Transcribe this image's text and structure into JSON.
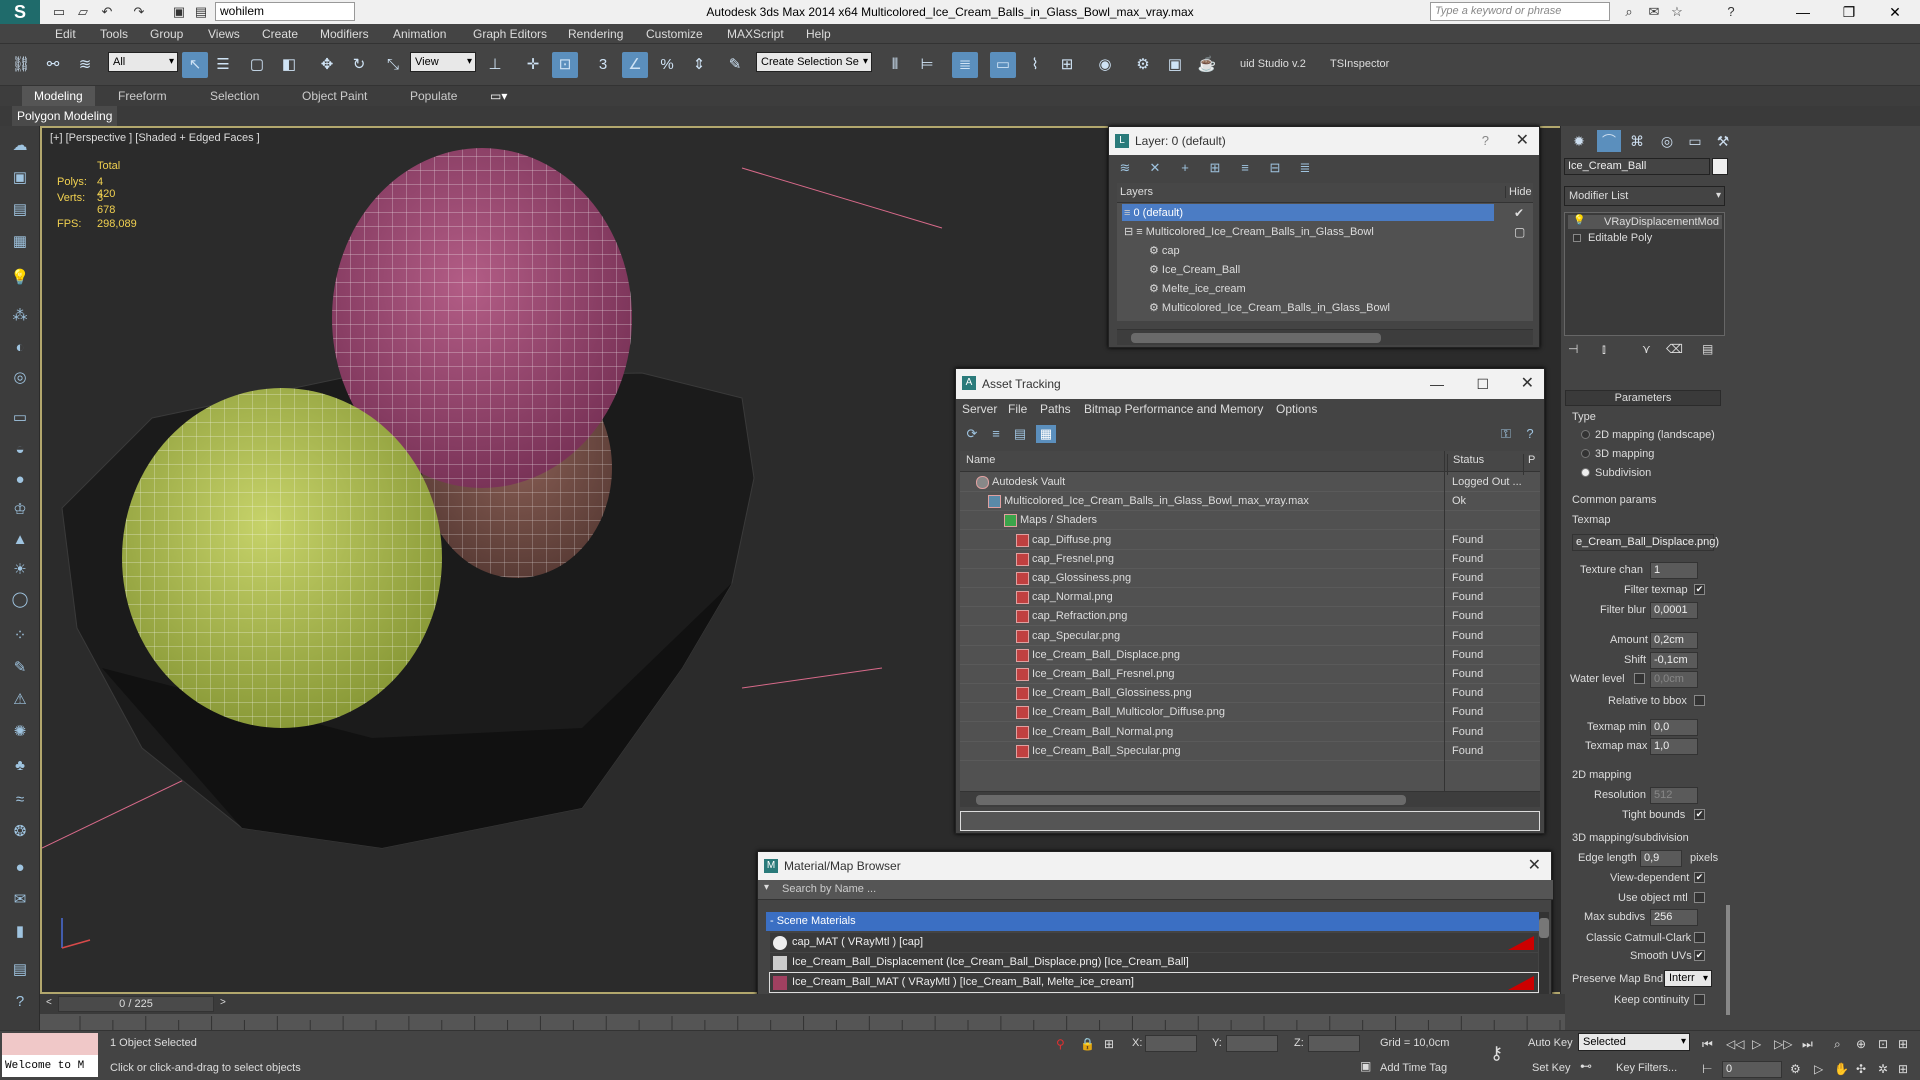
{
  "titlebar": {
    "workspace": "wohilem",
    "title": "Autodesk 3ds Max  2014 x64     Multicolored_Ice_Cream_Balls_in_Glass_Bowl_max_vray.max",
    "search_placeholder": "Type a keyword or phrase"
  },
  "menu": [
    "Edit",
    "Tools",
    "Group",
    "Views",
    "Create",
    "Modifiers",
    "Animation",
    "Graph Editors",
    "Rendering",
    "Customize",
    "MAXScript",
    "Help"
  ],
  "toolbar": {
    "selection_filter": "All",
    "ref_coord": "View",
    "named_selection": "Create Selection Se",
    "studio_label": "uid Studio v.2",
    "inspector_label": "TSInspector"
  },
  "ribbon": {
    "tabs": [
      "Modeling",
      "Freeform",
      "Selection",
      "Object Paint",
      "Populate"
    ],
    "sub": "Polygon Modeling"
  },
  "viewport": {
    "label": "[+] [Perspective ] [Shaded + Edged Faces ]",
    "stats": {
      "total_label": "Total",
      "polys_label": "Polys:",
      "polys": "4 420",
      "verts_label": "Verts:",
      "verts": "3 678",
      "fps_label": "FPS:",
      "fps": "298,089"
    }
  },
  "layer_panel": {
    "title": "Layer: 0 (default)",
    "col_layers": "Layers",
    "col_hide": "Hide",
    "rows": [
      "0 (default)",
      "Multicolored_Ice_Cream_Balls_in_Glass_Bowl",
      "cap",
      "Ice_Cream_Ball",
      "Melte_ice_cream",
      "Multicolored_Ice_Cream_Balls_in_Glass_Bowl"
    ]
  },
  "asset_panel": {
    "title": "Asset Tracking",
    "menu": [
      "Server",
      "File",
      "Paths",
      "Bitmap Performance and Memory",
      "Options"
    ],
    "col_name": "Name",
    "col_status": "Status",
    "col_p": "P",
    "rows": [
      {
        "name": "Autodesk Vault",
        "status": "Logged Out ..."
      },
      {
        "name": "Multicolored_Ice_Cream_Balls_in_Glass_Bowl_max_vray.max",
        "status": "Ok"
      },
      {
        "name": "Maps / Shaders",
        "status": ""
      },
      {
        "name": "cap_Diffuse.png",
        "status": "Found"
      },
      {
        "name": "cap_Fresnel.png",
        "status": "Found"
      },
      {
        "name": "cap_Glossiness.png",
        "status": "Found"
      },
      {
        "name": "cap_Normal.png",
        "status": "Found"
      },
      {
        "name": "cap_Refraction.png",
        "status": "Found"
      },
      {
        "name": "cap_Specular.png",
        "status": "Found"
      },
      {
        "name": "Ice_Cream_Ball_Displace.png",
        "status": "Found"
      },
      {
        "name": "Ice_Cream_Ball_Fresnel.png",
        "status": "Found"
      },
      {
        "name": "Ice_Cream_Ball_Glossiness.png",
        "status": "Found"
      },
      {
        "name": "Ice_Cream_Ball_Multicolor_Diffuse.png",
        "status": "Found"
      },
      {
        "name": "Ice_Cream_Ball_Normal.png",
        "status": "Found"
      },
      {
        "name": "Ice_Cream_Ball_Specular.png",
        "status": "Found"
      }
    ]
  },
  "mat_panel": {
    "title": "Material/Map Browser",
    "search_placeholder": "Search by Name ...",
    "section": "- Scene Materials",
    "rows": [
      "cap_MAT  ( VRayMtl )  [cap]",
      "Ice_Cream_Ball_Displacement (Ice_Cream_Ball_Displace.png) [Ice_Cream_Ball]",
      "Ice_Cream_Ball_MAT  ( VRayMtl )  [Ice_Cream_Ball, Melte_ice_cream]"
    ]
  },
  "cmd": {
    "object_name": "Ice_Cream_Ball",
    "modifier_list": "Modifier List",
    "stack": [
      "VRayDisplacementMod",
      "Editable Poly"
    ],
    "parameters": "Parameters",
    "type_label": "Type",
    "type_opts": [
      "2D mapping (landscape)",
      "3D mapping",
      "Subdivision"
    ],
    "common_params": "Common params",
    "texmap_label": "Texmap",
    "texmap_value": "e_Cream_Ball_Displace.png)",
    "texture_chan_label": "Texture chan",
    "texture_chan": "1",
    "filter_texmap": "Filter texmap",
    "filter_blur_label": "Filter blur",
    "filter_blur": "0,0001",
    "amount_label": "Amount",
    "amount": "0,2cm",
    "shift_label": "Shift",
    "shift": "-0,1cm",
    "water_label": "Water level",
    "water": "0,0cm",
    "relative_bbox": "Relative to bbox",
    "texmap_min_label": "Texmap min",
    "texmap_min": "0,0",
    "texmap_max_label": "Texmap max",
    "texmap_max": "1,0",
    "mapping2d": "2D mapping",
    "resolution_label": "Resolution",
    "resolution": "512",
    "tight_bounds": "Tight bounds",
    "mapping3d": "3D mapping/subdivision",
    "edge_length_label": "Edge length",
    "edge_length": "0,9",
    "pixels": "pixels",
    "view_dependent": "View-dependent",
    "use_object_mtl": "Use object mtl",
    "max_subdivs_label": "Max subdivs",
    "max_subdivs": "256",
    "classic_cc": "Classic Catmull-Clark",
    "smooth_uvs": "Smooth UVs",
    "preserve_label": "Preserve Map Bnd",
    "preserve": "Interr",
    "keep_continuity": "Keep continuity"
  },
  "timeline": {
    "frame": "0 / 225"
  },
  "status": {
    "selected": "1 Object Selected",
    "prompt": "Click or click-and-drag to select objects",
    "welcome": "Welcome to M",
    "x_label": "X:",
    "y_label": "Y:",
    "z_label": "Z:",
    "grid": "Grid = 10,0cm",
    "add_time_tag": "Add Time Tag",
    "auto_key": "Auto Key",
    "set_key": "Set Key",
    "key_mode": "Selected",
    "key_filters": "Key Filters...",
    "frame_field": "0"
  }
}
